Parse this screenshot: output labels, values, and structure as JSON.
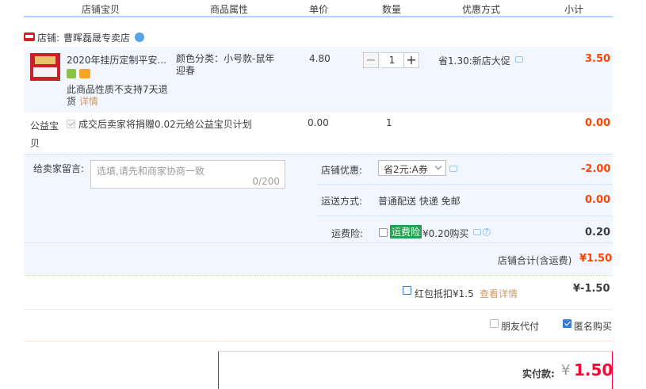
{
  "header": {
    "col_shop_item": "店铺宝贝",
    "col_attr": "商品属性",
    "col_price": "单价",
    "col_qty": "数量",
    "col_promo": "优惠方式",
    "col_subtotal": "小计"
  },
  "shop": {
    "label": "店铺:",
    "name": "曹晖磊晟专卖店",
    "badge_icon": "tmall-icon",
    "wangwang_icon": "chat-icon"
  },
  "item": {
    "title": "2020年挂历定制平安...",
    "attr": "颜色分类：小号款-鼠年迎春",
    "price": "4.80",
    "qty": "1",
    "qty_minus": "−",
    "qty_plus": "+",
    "promo": "省1.30:新店大促",
    "subtotal": "3.50",
    "no_return": "此商品性质不支持7天退货",
    "details_link": "详情"
  },
  "charity": {
    "label": "公益宝贝",
    "text": "成交后卖家将捐赠0.02元给公益宝贝计划",
    "price": "0.00",
    "qty": "1",
    "subtotal": "0.00"
  },
  "message": {
    "label": "给卖家留言:",
    "placeholder": "选填,请先和商家协商一致",
    "counter": "0/200"
  },
  "shop_discount": {
    "label": "店铺优惠:",
    "value": "省2元:A券",
    "amount": "-2.00"
  },
  "shipping": {
    "label": "运送方式:",
    "value": "普通配送 快递 免邮",
    "amount": "0.00"
  },
  "insurance": {
    "label": "运费险:",
    "tag": "运费险",
    "text": "¥0.20购买",
    "amount": "0.20"
  },
  "shop_total": {
    "label": "店铺合计(含运费)",
    "amount": "¥1.50"
  },
  "redpacket": {
    "label": "红包抵扣¥1.5",
    "link": "查看详情",
    "amount": "¥-1.50"
  },
  "options": {
    "friend_pay": "朋友代付",
    "anonymous": "匿名购买"
  },
  "payment": {
    "label": "实付款:",
    "currency": "¥",
    "amount": "1.50"
  },
  "colors": {
    "accent_red": "#ff0036",
    "price_red": "#ff4400",
    "header_line": "#b2d1ff",
    "panel_bg": "#f2f7ff"
  }
}
